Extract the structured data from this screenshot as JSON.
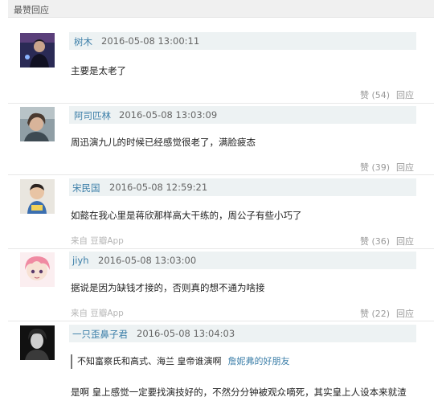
{
  "header": {
    "title": "最赞回应"
  },
  "comments": [
    {
      "username": "树木",
      "time": "2016-05-08 13:00:11",
      "content": "主要是太老了",
      "source": "",
      "like": "赞 (54)",
      "reply": "回应"
    },
    {
      "username": "阿司匹林",
      "time": "2016-05-08 13:03:09",
      "content": "周迅演九儿的时候已经感觉很老了，满脸疲态",
      "source": "",
      "like": "赞 (39)",
      "reply": "回应"
    },
    {
      "username": "宋民国",
      "time": "2016-05-08 12:59:21",
      "content": "如懿在我心里是蒋欣那样高大干练的，周公子有些小巧了",
      "source": "来自 豆瓣App",
      "like": "赞 (36)",
      "reply": "回应"
    },
    {
      "username": "jiyh",
      "time": "2016-05-08 13:03:00",
      "content": "据说是因为缺钱才接的，否则真的想不通为啥接",
      "source": "来自 豆瓣App",
      "like": "赞 (22)",
      "reply": "回应"
    },
    {
      "username": "一只歪鼻子君",
      "time": "2016-05-08 13:04:03",
      "quote_text": "不知富察氏和高式、海兰 皇帝谁演啊",
      "quote_author": "詹妮弗的好朋友",
      "content": "是啊 皇上感觉一定要找演技好的，不然分分钟被观众嘀死，其实皇上人设本来就渣"
    }
  ]
}
